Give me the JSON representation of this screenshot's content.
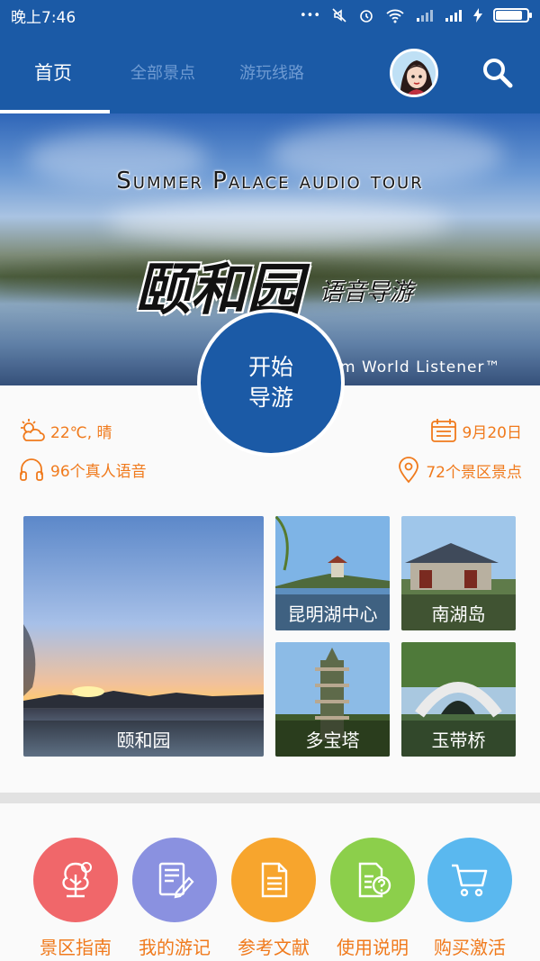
{
  "status_bar": {
    "time": "晚上7:46",
    "signal_text": "•••",
    "battery_level": 0.85
  },
  "header": {
    "tabs": [
      {
        "label": "首页",
        "active": true
      },
      {
        "label": "全部景点",
        "active": false
      },
      {
        "label": "游玩线路",
        "active": false
      }
    ],
    "accent_color": "#1b5aa6"
  },
  "banner": {
    "title_en": "Summer Palace audio tour",
    "title_cn": "颐和园",
    "subtitle_cn": "语音导游",
    "credit": "m World Listener™"
  },
  "start_button": {
    "line1": "开始",
    "line2": "导游"
  },
  "info": {
    "weather": "22℃, 晴",
    "date": "9月20日",
    "audio": "96个真人语音",
    "spots": "72个景区景点"
  },
  "tiles": [
    {
      "label": "颐和园"
    },
    {
      "label": "昆明湖中心"
    },
    {
      "label": "南湖岛"
    },
    {
      "label": "多宝塔"
    },
    {
      "label": "玉带桥"
    }
  ],
  "menu": [
    {
      "label": "景区指南",
      "color": "#f0676a",
      "icon": "tree-icon"
    },
    {
      "label": "我的游记",
      "color": "#8a91e0",
      "icon": "note-edit-icon"
    },
    {
      "label": "参考文献",
      "color": "#f7a52d",
      "icon": "document-icon"
    },
    {
      "label": "使用说明",
      "color": "#8ccf4b",
      "icon": "help-document-icon"
    },
    {
      "label": "购买激活",
      "color": "#5ab8ef",
      "icon": "cart-icon"
    }
  ]
}
